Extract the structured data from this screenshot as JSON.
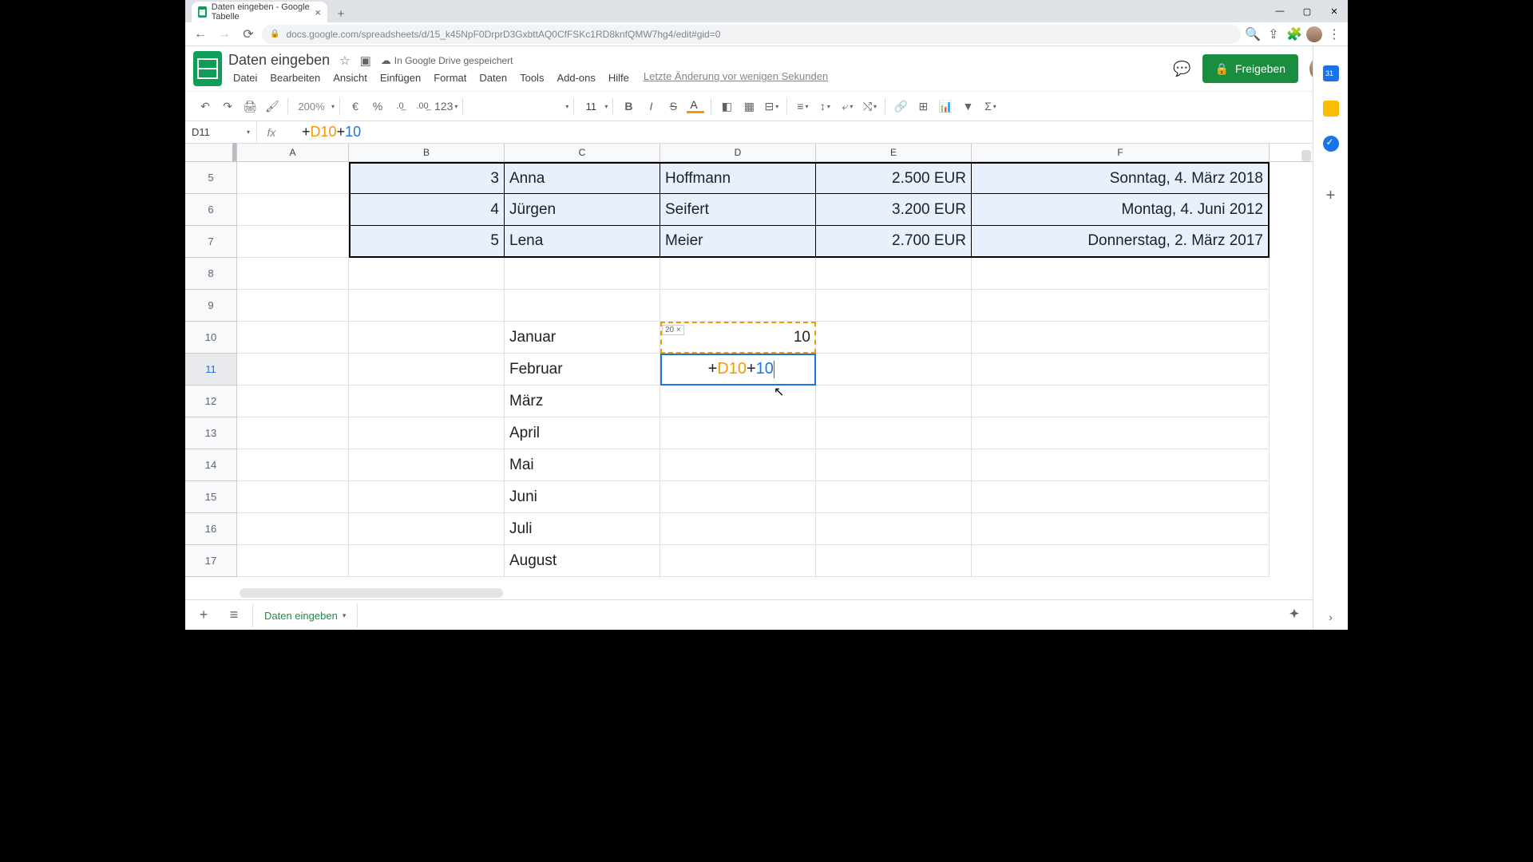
{
  "browser": {
    "tab_title": "Daten eingeben - Google Tabelle",
    "url": "docs.google.com/spreadsheets/d/15_k45NpF0DrprD3GxbttAQ0CfFSKc1RD8knfQMW7hg4/edit#gid=0"
  },
  "doc": {
    "title": "Daten eingeben",
    "save_status": "In Google Drive gespeichert",
    "last_edit": "Letzte Änderung vor wenigen Sekunden",
    "share_label": "Freigeben"
  },
  "menus": {
    "file": "Datei",
    "edit": "Bearbeiten",
    "view": "Ansicht",
    "insert": "Einfügen",
    "format": "Format",
    "data": "Daten",
    "tools": "Tools",
    "addons": "Add-ons",
    "help": "Hilfe"
  },
  "toolbar": {
    "zoom": "200%",
    "font": "",
    "font_size": "11",
    "currency": "€",
    "percent": "%",
    "dec_dec": ".0",
    "dec_inc": ".00",
    "fmt123": "123"
  },
  "namebox": "D11",
  "formula": {
    "parts": [
      "+",
      "D10",
      "+",
      "10"
    ]
  },
  "columns": [
    "A",
    "B",
    "C",
    "D",
    "E",
    "F"
  ],
  "rows": [
    {
      "n": "5",
      "b": "3",
      "c": "Anna",
      "d": "Hoffmann",
      "e": "2.500 EUR",
      "f": "Sonntag, 4. März 2018"
    },
    {
      "n": "6",
      "b": "4",
      "c": "Jürgen",
      "d": "Seifert",
      "e": "3.200 EUR",
      "f": "Montag, 4. Juni 2012"
    },
    {
      "n": "7",
      "b": "5",
      "c": "Lena",
      "d": "Meier",
      "e": "2.700 EUR",
      "f": "Donnerstag, 2. März 2017"
    },
    {
      "n": "8"
    },
    {
      "n": "9"
    },
    {
      "n": "10",
      "c": "Januar",
      "d": "10",
      "d10_hint": "20 ×"
    },
    {
      "n": "11",
      "c": "Februar",
      "d_edit_parts": [
        "+",
        "D10",
        "+",
        "10"
      ]
    },
    {
      "n": "12",
      "c": "März"
    },
    {
      "n": "13",
      "c": "April"
    },
    {
      "n": "14",
      "c": "Mai"
    },
    {
      "n": "15",
      "c": "Juni"
    },
    {
      "n": "16",
      "c": "Juli"
    },
    {
      "n": "17",
      "c": "August"
    }
  ],
  "sheet_tab": "Daten eingeben"
}
